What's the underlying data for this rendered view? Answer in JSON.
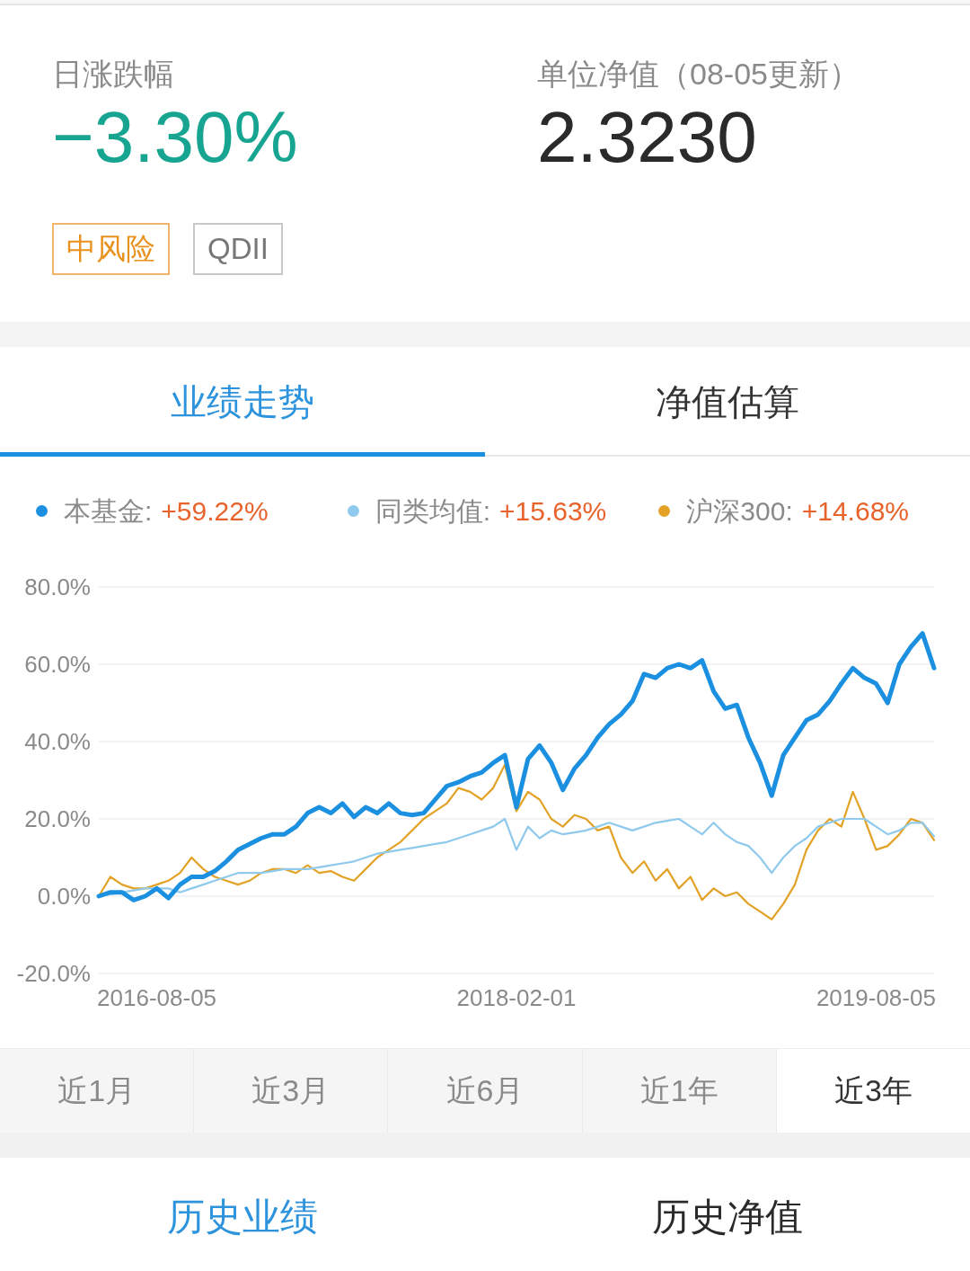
{
  "summary": {
    "daily_change": {
      "label": "日涨跌幅",
      "value": "−3.30%"
    },
    "nav": {
      "label": "单位净值（08-05更新）",
      "value": "2.3230"
    },
    "tags": [
      {
        "label": "中风险",
        "kind": "risk"
      },
      {
        "label": "QDII",
        "kind": "plain"
      }
    ]
  },
  "tabs": [
    {
      "label": "业绩走势",
      "selected": true
    },
    {
      "label": "净值估算",
      "selected": false
    }
  ],
  "legend": [
    {
      "value": "+59.22%"
    },
    {
      "value": "+15.63%"
    },
    {
      "value": "+14.68%"
    }
  ],
  "chart": {
    "chart_data": {
      "type": "line",
      "grid": true,
      "categories": [
        null,
        null,
        null,
        null,
        null,
        "2016-08-05",
        null,
        null,
        null,
        null,
        null,
        null,
        null,
        null,
        null,
        null,
        null,
        null,
        null,
        null,
        null,
        null,
        null,
        null,
        null,
        null,
        null,
        null,
        null,
        null,
        null,
        null,
        null,
        null,
        null,
        null,
        "2018-02-01",
        null,
        null,
        null,
        null,
        null,
        null,
        null,
        null,
        null,
        null,
        null,
        null,
        null,
        null,
        null,
        null,
        null,
        null,
        null,
        null,
        null,
        null,
        null,
        null,
        null,
        null,
        null,
        null,
        null,
        null,
        "2019-08-05",
        null,
        null,
        null,
        null,
        null
      ],
      "ylim": [
        -20,
        80
      ],
      "yticks": [
        {
          "value": 80,
          "label": "80.0%"
        },
        {
          "value": 60,
          "label": "60.0%"
        },
        {
          "value": 40,
          "label": "40.0%"
        },
        {
          "value": 20,
          "label": "20.0%"
        },
        {
          "value": 0,
          "label": "0.0%"
        },
        {
          "value": -20,
          "label": "-20.0%"
        }
      ],
      "series": [
        {
          "name": "本基金:",
          "color": "#1b8fe0",
          "values": [
            0,
            1,
            1,
            -1,
            0,
            2,
            -0.5,
            3,
            5,
            5,
            6.5,
            9,
            12,
            13.5,
            15,
            16,
            16,
            18,
            21.5,
            23,
            21.5,
            24,
            20.5,
            23,
            21.5,
            24,
            21.5,
            21,
            21.5,
            25,
            28.5,
            29.5,
            31,
            32,
            34.5,
            36.5,
            23,
            35.5,
            39,
            34.5,
            27.5,
            33,
            36.5,
            41,
            44.5,
            47,
            50.5,
            57.5,
            56.5,
            59,
            60,
            59,
            61,
            53,
            48.5,
            49.5,
            41,
            34.5,
            26,
            36.5,
            41,
            45.5,
            47,
            50.5,
            55,
            59,
            56.5,
            55,
            50,
            60,
            64.5,
            68,
            59
          ]
        },
        {
          "name": "同类均值:",
          "color": "#8fcaed",
          "values": [
            0,
            0.5,
            1,
            1.5,
            2,
            2,
            2,
            1,
            2,
            3,
            4,
            5,
            6,
            6,
            6,
            6.5,
            7,
            7,
            7,
            7.5,
            8,
            8.5,
            9,
            10,
            11,
            11.5,
            12,
            12.5,
            13,
            13.5,
            14,
            15,
            16,
            17,
            18,
            20,
            12,
            18,
            15,
            17,
            16,
            16.5,
            17,
            18,
            19,
            18,
            17,
            18,
            19,
            19.5,
            20,
            18,
            16,
            19,
            16,
            14,
            13,
            10,
            6,
            10,
            13,
            15,
            18,
            19,
            20,
            20,
            20,
            18,
            16,
            17,
            19,
            19,
            15.5
          ]
        },
        {
          "name": "沪深300:",
          "color": "#e2a226",
          "values": [
            0,
            5,
            3,
            2,
            2,
            3,
            4,
            6,
            10,
            7,
            5,
            4,
            3,
            4,
            6,
            7,
            7,
            6,
            8,
            6,
            6.5,
            5,
            4,
            7,
            10,
            12,
            14,
            17,
            20,
            22,
            24,
            28,
            27,
            25,
            28,
            34,
            22,
            27,
            25,
            20,
            18,
            21,
            20,
            17,
            18,
            10,
            6,
            9,
            4,
            7,
            2,
            5,
            -1,
            2,
            0,
            1,
            -2,
            -4,
            -6,
            -2,
            3,
            12,
            17,
            20,
            18,
            27,
            20,
            12,
            13,
            16,
            20,
            19,
            14.5
          ]
        }
      ]
    }
  },
  "ranges": [
    {
      "label": "近1月",
      "selected": false
    },
    {
      "label": "近3月",
      "selected": false
    },
    {
      "label": "近6月",
      "selected": false
    },
    {
      "label": "近1年",
      "selected": false
    },
    {
      "label": "近3年",
      "selected": true
    }
  ],
  "bottom_tabs": [
    {
      "label": "历史业绩",
      "selected": true
    },
    {
      "label": "历史净值",
      "selected": false
    }
  ]
}
